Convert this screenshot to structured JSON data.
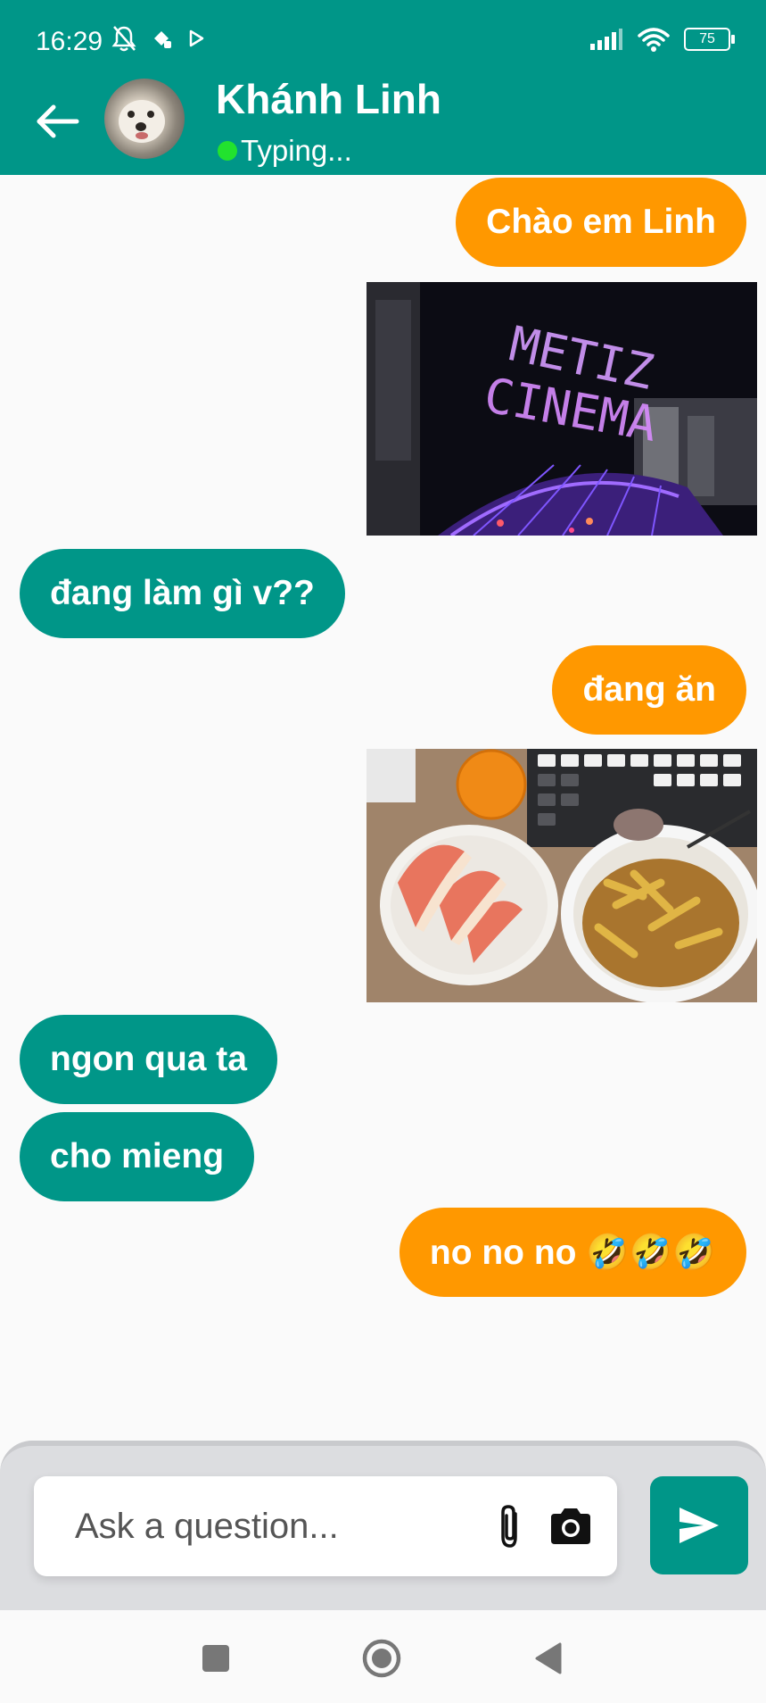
{
  "status_bar": {
    "time": "16:29",
    "battery": "75"
  },
  "contact": {
    "name": "Khánh Linh",
    "status": "Typing..."
  },
  "messages": [
    {
      "type": "text",
      "direction": "outgoing",
      "text": "Chào em Linh"
    },
    {
      "type": "image",
      "direction": "outgoing",
      "image": "metiz-cinema-photo"
    },
    {
      "type": "text",
      "direction": "incoming",
      "text": "đang làm gì v??"
    },
    {
      "type": "text",
      "direction": "outgoing",
      "text": "đang ăn"
    },
    {
      "type": "image",
      "direction": "outgoing",
      "image": "food-photo"
    },
    {
      "type": "text",
      "direction": "incoming",
      "text": "ngon qua ta"
    },
    {
      "type": "text",
      "direction": "incoming",
      "text": "cho mieng"
    },
    {
      "type": "text",
      "direction": "outgoing",
      "text": "no no no 🤣🤣🤣"
    }
  ],
  "composer": {
    "placeholder": "Ask a question..."
  },
  "icons": {
    "back": "arrow-left-icon",
    "attach": "paperclip-icon",
    "camera": "camera-icon",
    "send": "send-icon",
    "nav": [
      "square-icon",
      "circle-icon",
      "triangle-back-icon"
    ]
  },
  "colors": {
    "primary": "#009688",
    "outgoing_bubble": "#ff9800",
    "online": "#22e22e"
  }
}
